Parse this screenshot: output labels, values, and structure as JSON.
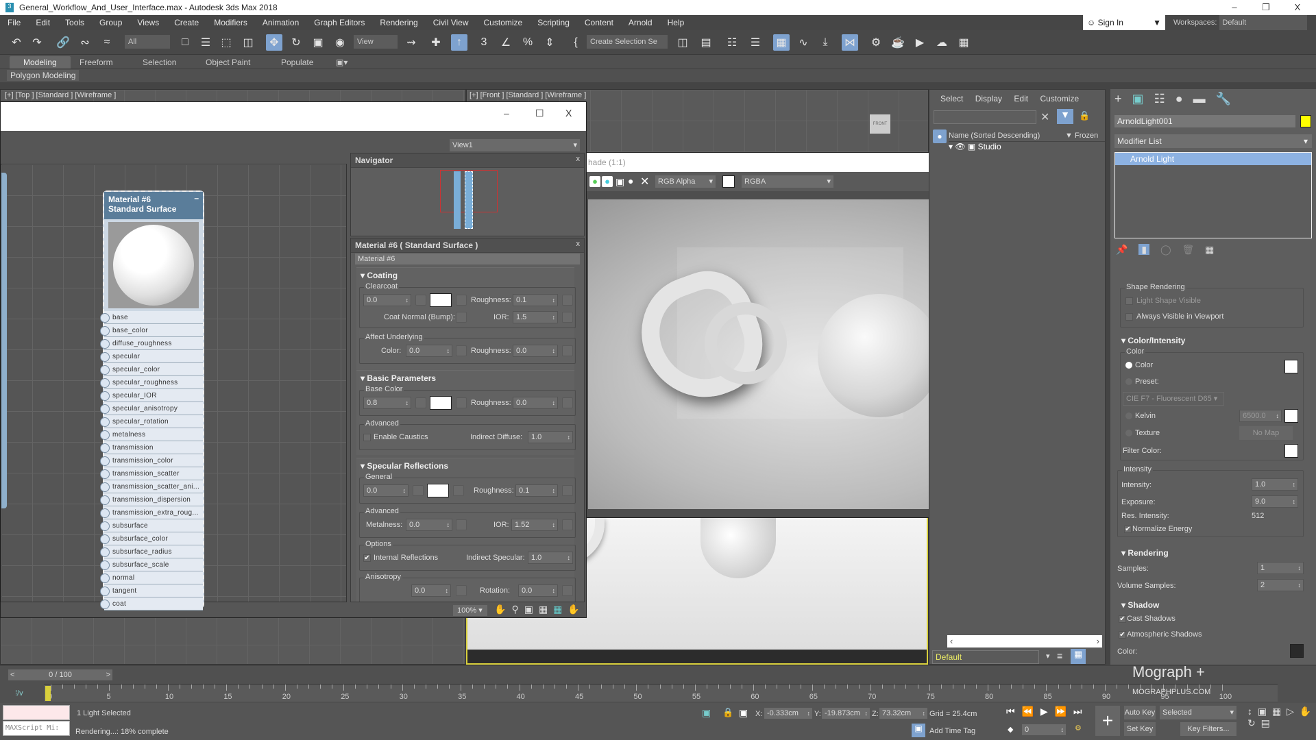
{
  "app": {
    "title": "General_Workflow_And_User_Interface.max - Autodesk 3ds Max 2018",
    "logo": "3",
    "minimize": "–",
    "restore": "❐",
    "close": "X"
  },
  "menu": [
    "File",
    "Edit",
    "Tools",
    "Group",
    "Views",
    "Create",
    "Modifiers",
    "Animation",
    "Graph Editors",
    "Rendering",
    "Civil View",
    "Customize",
    "Scripting",
    "Content",
    "Arnold",
    "Help"
  ],
  "signin": {
    "label": "Sign In",
    "arrow": "▼"
  },
  "workspace": {
    "label": "Workspaces:",
    "value": "Default"
  },
  "toolbar": {
    "filter": "All",
    "refcoord": "View",
    "named_sel": "Create Selection Se"
  },
  "ribbon": {
    "tabs": [
      "Modeling",
      "Freeform",
      "Selection",
      "Object Paint",
      "Populate"
    ],
    "active": "Modeling",
    "subtab": "Polygon Modeling"
  },
  "viewports": {
    "top": "[+] [Top ] [Standard ] [Wireframe ]",
    "front": "[+] [Front ] [Standard ] [Wireframe ]",
    "front_cube": "FRONT"
  },
  "slate": {
    "min": "–",
    "max": "☐",
    "close": "X",
    "view_dropdown": "View1",
    "navigator": {
      "title": "Navigator",
      "close": "x"
    },
    "node": {
      "title1": "Material #6",
      "title2": "Standard Surface",
      "collapse": "–",
      "slots": [
        "base",
        "base_color",
        "diffuse_roughness",
        "specular",
        "specular_color",
        "specular_roughness",
        "specular_IOR",
        "specular_anisotropy",
        "specular_rotation",
        "metalness",
        "transmission",
        "transmission_color",
        "transmission_scatter",
        "transmission_scatter_ani...",
        "transmission_dispersion",
        "transmission_extra_roug...",
        "subsurface",
        "subsurface_color",
        "subsurface_radius",
        "subsurface_scale",
        "normal",
        "tangent",
        "coat"
      ]
    },
    "params": {
      "title": "Material #6  ( Standard Surface )",
      "close": "x",
      "name": "Material #6",
      "coating": {
        "title": "Coating",
        "clearcoat": "Clearcoat",
        "clearcoat_val": "0.0",
        "roughness_lbl": "Roughness:",
        "roughness": "0.1",
        "coat_normal": "Coat Normal (Bump):",
        "ior_lbl": "IOR:",
        "ior": "1.5",
        "affect": "Affect Underlying",
        "color_lbl": "Color:",
        "color": "0.0",
        "aff_rough": "0.0"
      },
      "basic": {
        "title": "Basic Parameters",
        "base_color": "Base Color",
        "base_val": "0.8",
        "roughness": "0.0",
        "advanced": "Advanced",
        "caustics": "Enable Caustics",
        "indirect_diffuse_lbl": "Indirect Diffuse:",
        "indirect_diffuse": "1.0"
      },
      "specular": {
        "title": "Specular Reflections",
        "general": "General",
        "val": "0.0",
        "roughness": "0.1",
        "advanced": "Advanced",
        "metalness_lbl": "Metalness:",
        "metalness": "0.0",
        "ior": "1.52",
        "options": "Options",
        "internal": "Internal Reflections",
        "indirect_spec_lbl": "Indirect Specular:",
        "indirect_spec": "1.0",
        "anisotropy": "Anisotropy",
        "aniso": "0.0",
        "rotation_lbl": "Rotation:",
        "rotation": "0.0"
      }
    },
    "zoom": "100%"
  },
  "render": {
    "title": "hade (1:1)",
    "min": "–",
    "max": "☐",
    "close": "X",
    "channel": "RGB Alpha",
    "display": "RGBA",
    "close_x": "✕"
  },
  "explorer": {
    "menu": [
      "Select",
      "Display",
      "Edit",
      "Customize"
    ],
    "col_name": "Name (Sorted Descending)",
    "col_frozen": "Frozen",
    "row": "Studio",
    "layer": "Default"
  },
  "command": {
    "object_name": "ArnoldLight001",
    "object_color": "#ffff00",
    "modifier_list": "Modifier List",
    "stack_item": "Arnold Light",
    "shape": {
      "title": "Shape Rendering",
      "visible": "Light Shape Visible",
      "always": "Always Visible in Viewport"
    },
    "color": {
      "title": "Color/Intensity",
      "group": "Color",
      "color": "Color",
      "preset": "Preset:",
      "preset_val": "CIE F7 - Fluorescent D65",
      "kelvin": "Kelvin",
      "kelvin_val": "6500.0",
      "texture": "Texture",
      "nomap": "No Map",
      "filter": "Filter Color:"
    },
    "intensity": {
      "group": "Intensity",
      "intensity_lbl": "Intensity:",
      "intensity": "1.0",
      "exposure_lbl": "Exposure:",
      "exposure": "9.0",
      "res_lbl": "Res. Intensity:",
      "res": "512",
      "normalize": "Normalize Energy"
    },
    "rendering": {
      "title": "Rendering",
      "samples_lbl": "Samples:",
      "samples": "1",
      "vol_lbl": "Volume Samples:",
      "vol": "2"
    },
    "shadow": {
      "title": "Shadow",
      "cast": "Cast Shadows",
      "atmos": "Atmospheric Shadows",
      "color_lbl": "Color:"
    }
  },
  "timeline": {
    "frame": "0 / 100",
    "ticks": [
      "0",
      "5",
      "10",
      "15",
      "20",
      "25",
      "30",
      "35",
      "40",
      "45",
      "50",
      "55",
      "60",
      "65",
      "70",
      "75",
      "80",
      "85",
      "90",
      "95",
      "100"
    ]
  },
  "status": {
    "selected": "1 Light Selected",
    "progress": "Rendering...: 18% complete",
    "render_progress_pct": 18,
    "maxscript": "MAXScript Mi:",
    "x_lbl": "X:",
    "x": "-0.333cm",
    "y_lbl": "Y:",
    "y": "-19.873cm",
    "z_lbl": "Z:",
    "z": "73.32cm",
    "grid": "Grid = 25.4cm",
    "add_time_tag": "Add Time Tag",
    "frame": "0",
    "auto_key": "Auto Key",
    "set_key": "Set Key",
    "selected_dd": "Selected",
    "key_filters": "Key Filters..."
  },
  "watermark": {
    "brand": "Mograph +",
    "url": "MOGRAPHPLUS.COM"
  }
}
